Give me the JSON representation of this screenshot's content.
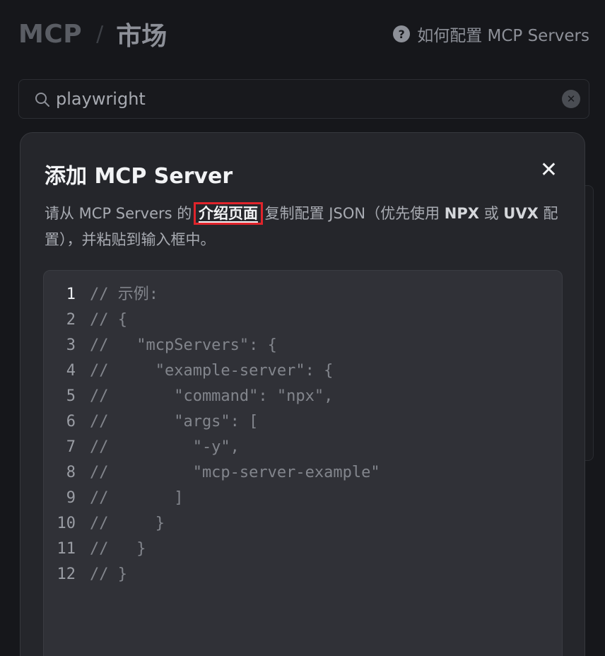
{
  "header": {
    "breadcrumb_root": "MCP",
    "breadcrumb_separator": "/",
    "breadcrumb_current": "市场",
    "help_link": "如何配置 MCP Servers",
    "help_icon": "question-circle-icon"
  },
  "search": {
    "value": "playwright",
    "icon": "search-icon",
    "clear_icon": "clear-icon"
  },
  "modal": {
    "title": "添加 MCP Server",
    "close_label": "✕",
    "description": {
      "part1": "请从 MCP Servers 的 ",
      "link": "介绍页面",
      "part2": " 复制配置 JSON（优先使用 ",
      "bold1": "NPX",
      "part3": " 或 ",
      "bold2": "UVX",
      "part4": " 配置），并粘贴到输入框中。"
    },
    "code_lines": [
      {
        "n": "1",
        "text": "// 示例:"
      },
      {
        "n": "2",
        "text": "// {"
      },
      {
        "n": "3",
        "text": "//   \"mcpServers\": {"
      },
      {
        "n": "4",
        "text": "//     \"example-server\": {"
      },
      {
        "n": "5",
        "text": "//       \"command\": \"npx\","
      },
      {
        "n": "6",
        "text": "//       \"args\": ["
      },
      {
        "n": "7",
        "text": "//         \"-y\","
      },
      {
        "n": "8",
        "text": "//         \"mcp-server-example\""
      },
      {
        "n": "9",
        "text": "//       ]"
      },
      {
        "n": "10",
        "text": "//     }"
      },
      {
        "n": "11",
        "text": "//   }"
      },
      {
        "n": "12",
        "text": "// }"
      }
    ]
  },
  "colors": {
    "background": "#16171b",
    "modal": "#25262b",
    "editor": "#303137",
    "highlight": "#e0242b"
  }
}
